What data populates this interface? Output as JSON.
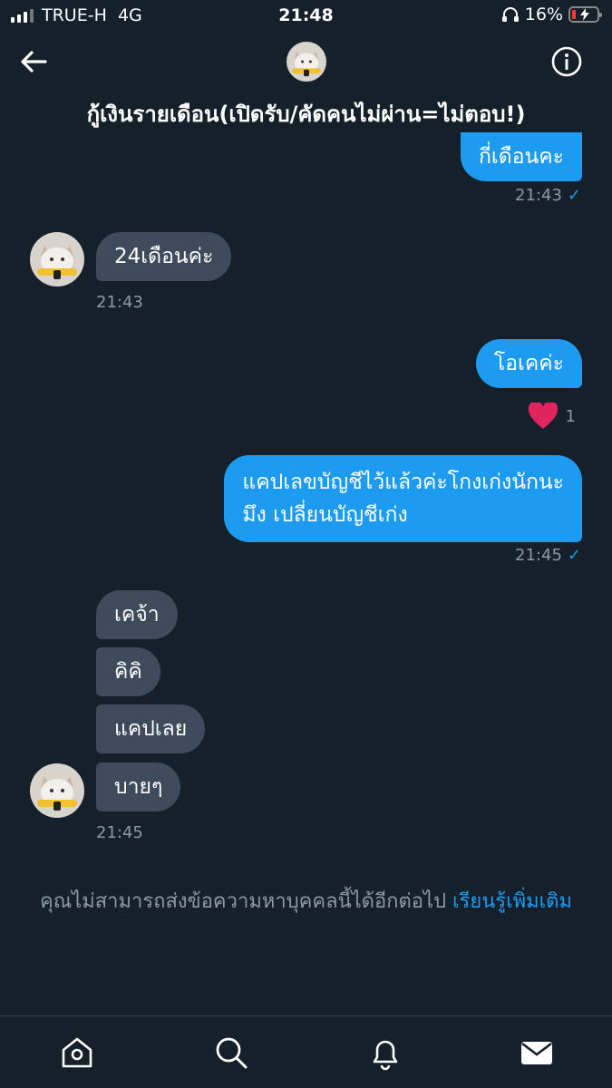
{
  "status_bar": {
    "carrier": "TRUE-H",
    "network": "4G",
    "time": "21:48",
    "battery": "16%",
    "battery_level": 0.16,
    "icons": [
      "signal-icon",
      "headphones-icon",
      "battery-charging-icon"
    ]
  },
  "header": {
    "title": "กู้เงินรายเดือน(เปิดรับ/คัดคนไม่ผ่าน=ไม่ตอบ!)",
    "icons": [
      "back-arrow-icon",
      "info-icon"
    ]
  },
  "messages": [
    {
      "text": "กี่เดือนคะ",
      "direction": "outgoing",
      "time": "21:43"
    },
    {
      "text": "24เดือนค่ะ",
      "direction": "incoming",
      "time": "21:43"
    },
    {
      "text": "โอเคค่ะ",
      "direction": "outgoing",
      "reaction_count": "1"
    },
    {
      "text": "แคปเลขบัญชีไว้แล้วค่ะโกงเก่งนักนะ",
      "text2": "มึง เปลี่ยนบัญชีเก่ง",
      "direction": "outgoing",
      "time": "21:45"
    },
    {
      "text": "เคจ้า",
      "direction": "incoming"
    },
    {
      "text": "คิคิ",
      "direction": "incoming"
    },
    {
      "text": "แคปเลย",
      "direction": "incoming"
    },
    {
      "text": "บายๆ",
      "direction": "incoming",
      "time": "21:45"
    }
  ],
  "notice": {
    "text": "คุณไม่สามารถส่งข้อความหาบุคคลนี้ได้อีกต่อไป ",
    "link": "เรียนรู้เพิ่มเติม"
  },
  "tabbar": [
    "home-icon",
    "search-icon",
    "notifications-icon",
    "messages-icon"
  ],
  "colors": {
    "background": "#15202b",
    "outgoing_bubble": "#1d9bf0",
    "incoming_bubble": "#3d4b5c",
    "muted_text": "#8b98a5",
    "reaction_heart": "#e0245e"
  }
}
